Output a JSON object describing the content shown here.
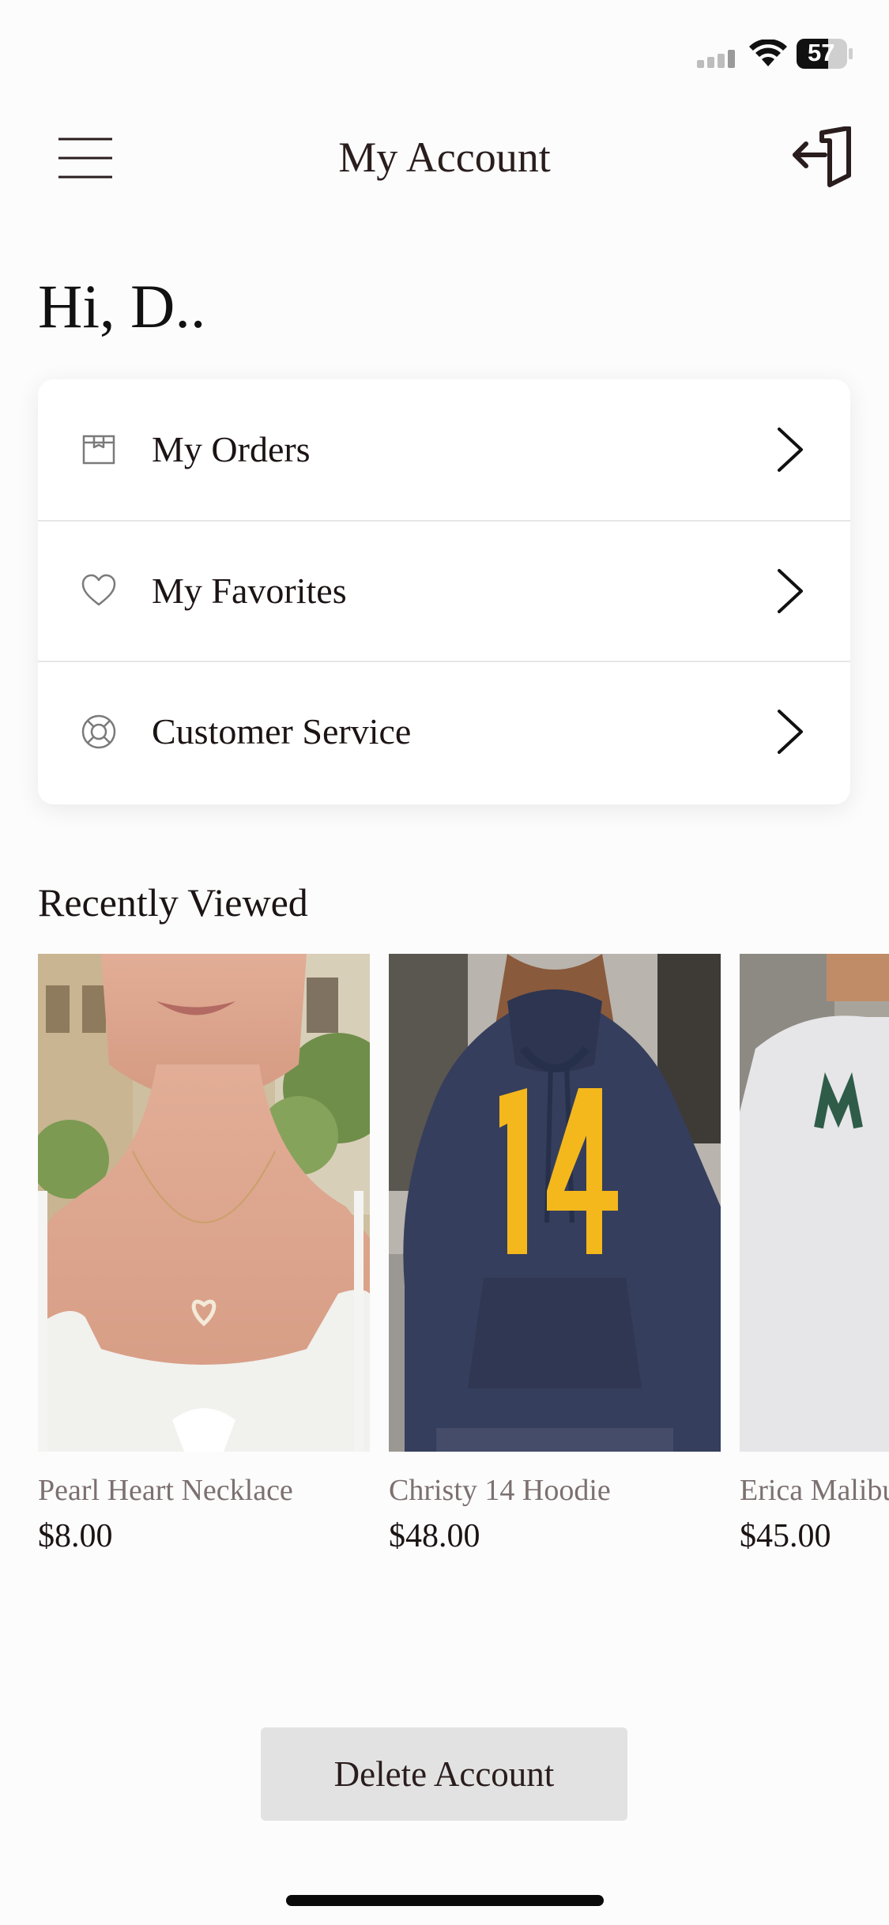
{
  "status_bar": {
    "battery_level": "57",
    "signal_icon": "signal-bars-icon",
    "wifi_icon": "wifi-icon",
    "battery_icon": "battery-icon"
  },
  "header": {
    "title": "My Account",
    "menu_icon": "hamburger-menu-icon",
    "logout_icon": "logout-icon"
  },
  "greeting": "Hi,  D..",
  "menu": {
    "items": [
      {
        "label": "My Orders",
        "icon": "box-icon"
      },
      {
        "label": "My Favorites",
        "icon": "heart-icon"
      },
      {
        "label": "Customer Service",
        "icon": "lifebuoy-icon"
      }
    ]
  },
  "recently_viewed": {
    "title": "Recently Viewed",
    "products": [
      {
        "name": "Pearl Heart Necklace",
        "price": "$8.00"
      },
      {
        "name": "Christy 14 Hoodie",
        "price": "$48.00"
      },
      {
        "name": "Erica Malibu",
        "price": "$45.00"
      }
    ]
  },
  "delete_account_label": "Delete Account",
  "colors": {
    "background": "#fcfcfc",
    "text": "#1c1414",
    "muted_text": "#7c7070",
    "button_bg": "#e2e2e2"
  }
}
